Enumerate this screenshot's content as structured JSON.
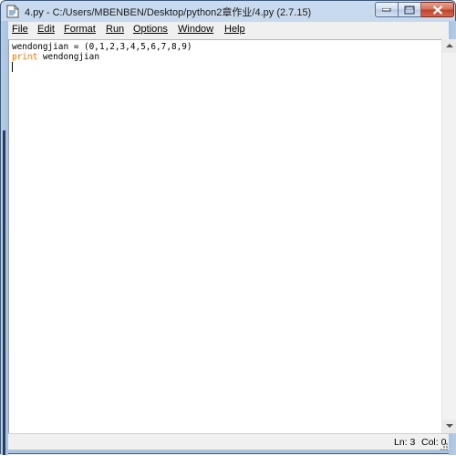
{
  "window": {
    "title": "4.py - C:/Users/MBENBEN/Desktop/python2章作业/4.py (2.7.15)",
    "accent_color": "#b7cde6",
    "close_color": "#c3432a"
  },
  "menu": {
    "items": [
      {
        "label": "File"
      },
      {
        "label": "Edit"
      },
      {
        "label": "Format"
      },
      {
        "label": "Run"
      },
      {
        "label": "Options"
      },
      {
        "label": "Window"
      },
      {
        "label": "Help"
      }
    ]
  },
  "editor": {
    "lines": [
      {
        "code": "wendongjian = (0,1,2,3,4,5,6,7,8,9)"
      },
      {
        "keyword": "print",
        "code": " wendongjian"
      }
    ],
    "keyword_color": "#ff7700"
  },
  "status": {
    "line": "Ln: 3",
    "col": "Col: 0"
  },
  "icons": {
    "app": "idle-file-icon",
    "minimize": "minimize-icon",
    "maximize": "maximize-icon",
    "close": "close-icon",
    "scroll_up": "chevron-up-icon",
    "scroll_down": "chevron-down-icon",
    "grip": "resize-grip-icon"
  }
}
